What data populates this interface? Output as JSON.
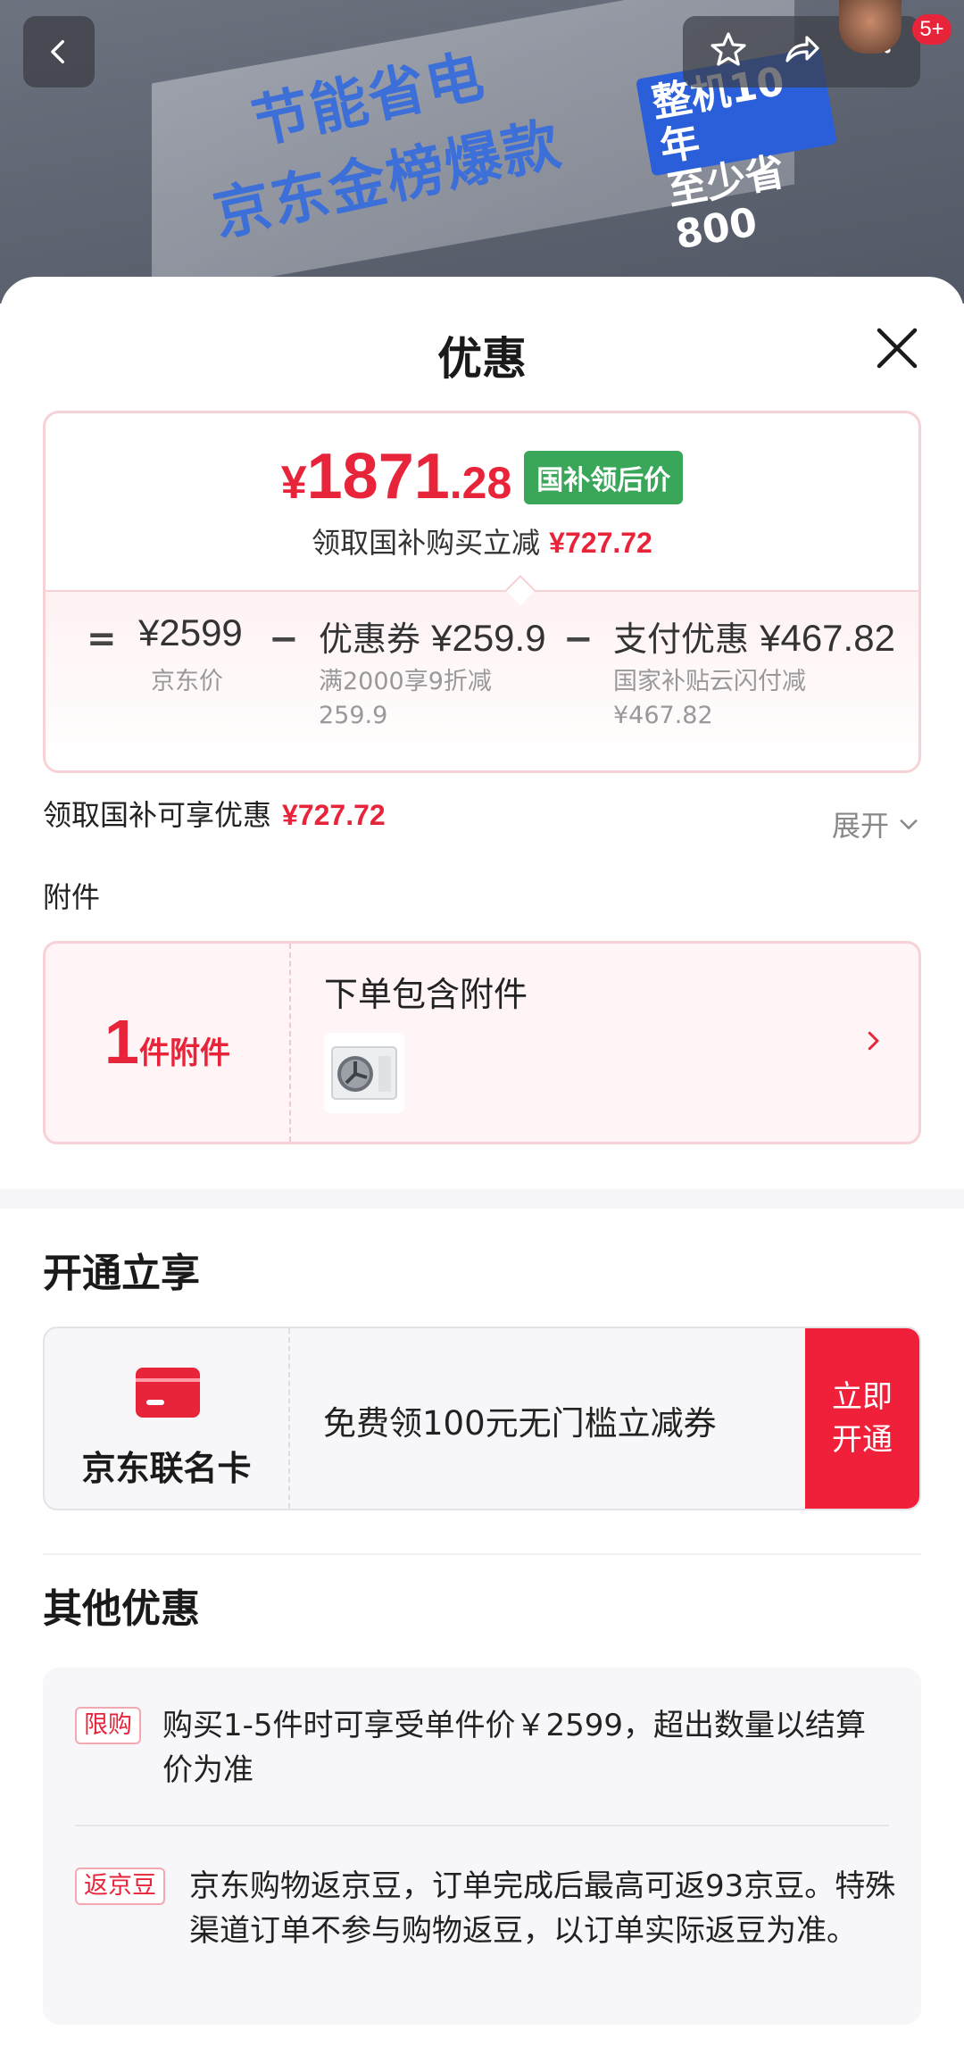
{
  "hero": {
    "banner_line1": "节能省电",
    "banner_line2": "京东金榜爆款",
    "tag_line1": "整机10年",
    "tag_line2": "至少省800",
    "notification_badge": "5+"
  },
  "sheet": {
    "title": "优惠"
  },
  "price_card": {
    "currency": "¥",
    "price_int": "1871",
    "price_dec": ".28",
    "tag": "国补领后价",
    "subtitle": "领取国补购买立减",
    "subtitle_amount": "¥727.72",
    "eq": "=",
    "minus": "−",
    "jd_price": "¥2599",
    "jd_price_label": "京东价",
    "coupon_label": "优惠券",
    "coupon_amount": "¥259.9",
    "coupon_note": "满2000享9折减 259.9",
    "pay_label": "支付优惠",
    "pay_amount": "¥467.82",
    "pay_note": "国家补贴云闪付减 ¥467.82"
  },
  "discount_summary": {
    "label": "领取国补可享优惠",
    "amount": "¥727.72",
    "expand_label": "展开"
  },
  "accessories": {
    "section_label": "附件",
    "count": "1",
    "count_unit": "件附件",
    "title": "下单包含附件"
  },
  "open_enjoy": {
    "heading": "开通立享",
    "card_name": "京东联名卡",
    "offer_text": "免费领100元无门槛立减券",
    "cta_line1": "立即",
    "cta_line2": "开通"
  },
  "other": {
    "heading": "其他优惠",
    "items": [
      {
        "tag": "限购",
        "text": "购买1-5件时可享受单件价￥2599，超出数量以结算价为准"
      },
      {
        "tag": "返京豆",
        "text": "京东购物返京豆，订单完成后最高可返93京豆。特殊渠道订单不参与购物返豆，以订单实际返豆为准。"
      }
    ]
  },
  "colors": {
    "accent_red": "#e8243a",
    "gov_green": "#3aa65a"
  }
}
